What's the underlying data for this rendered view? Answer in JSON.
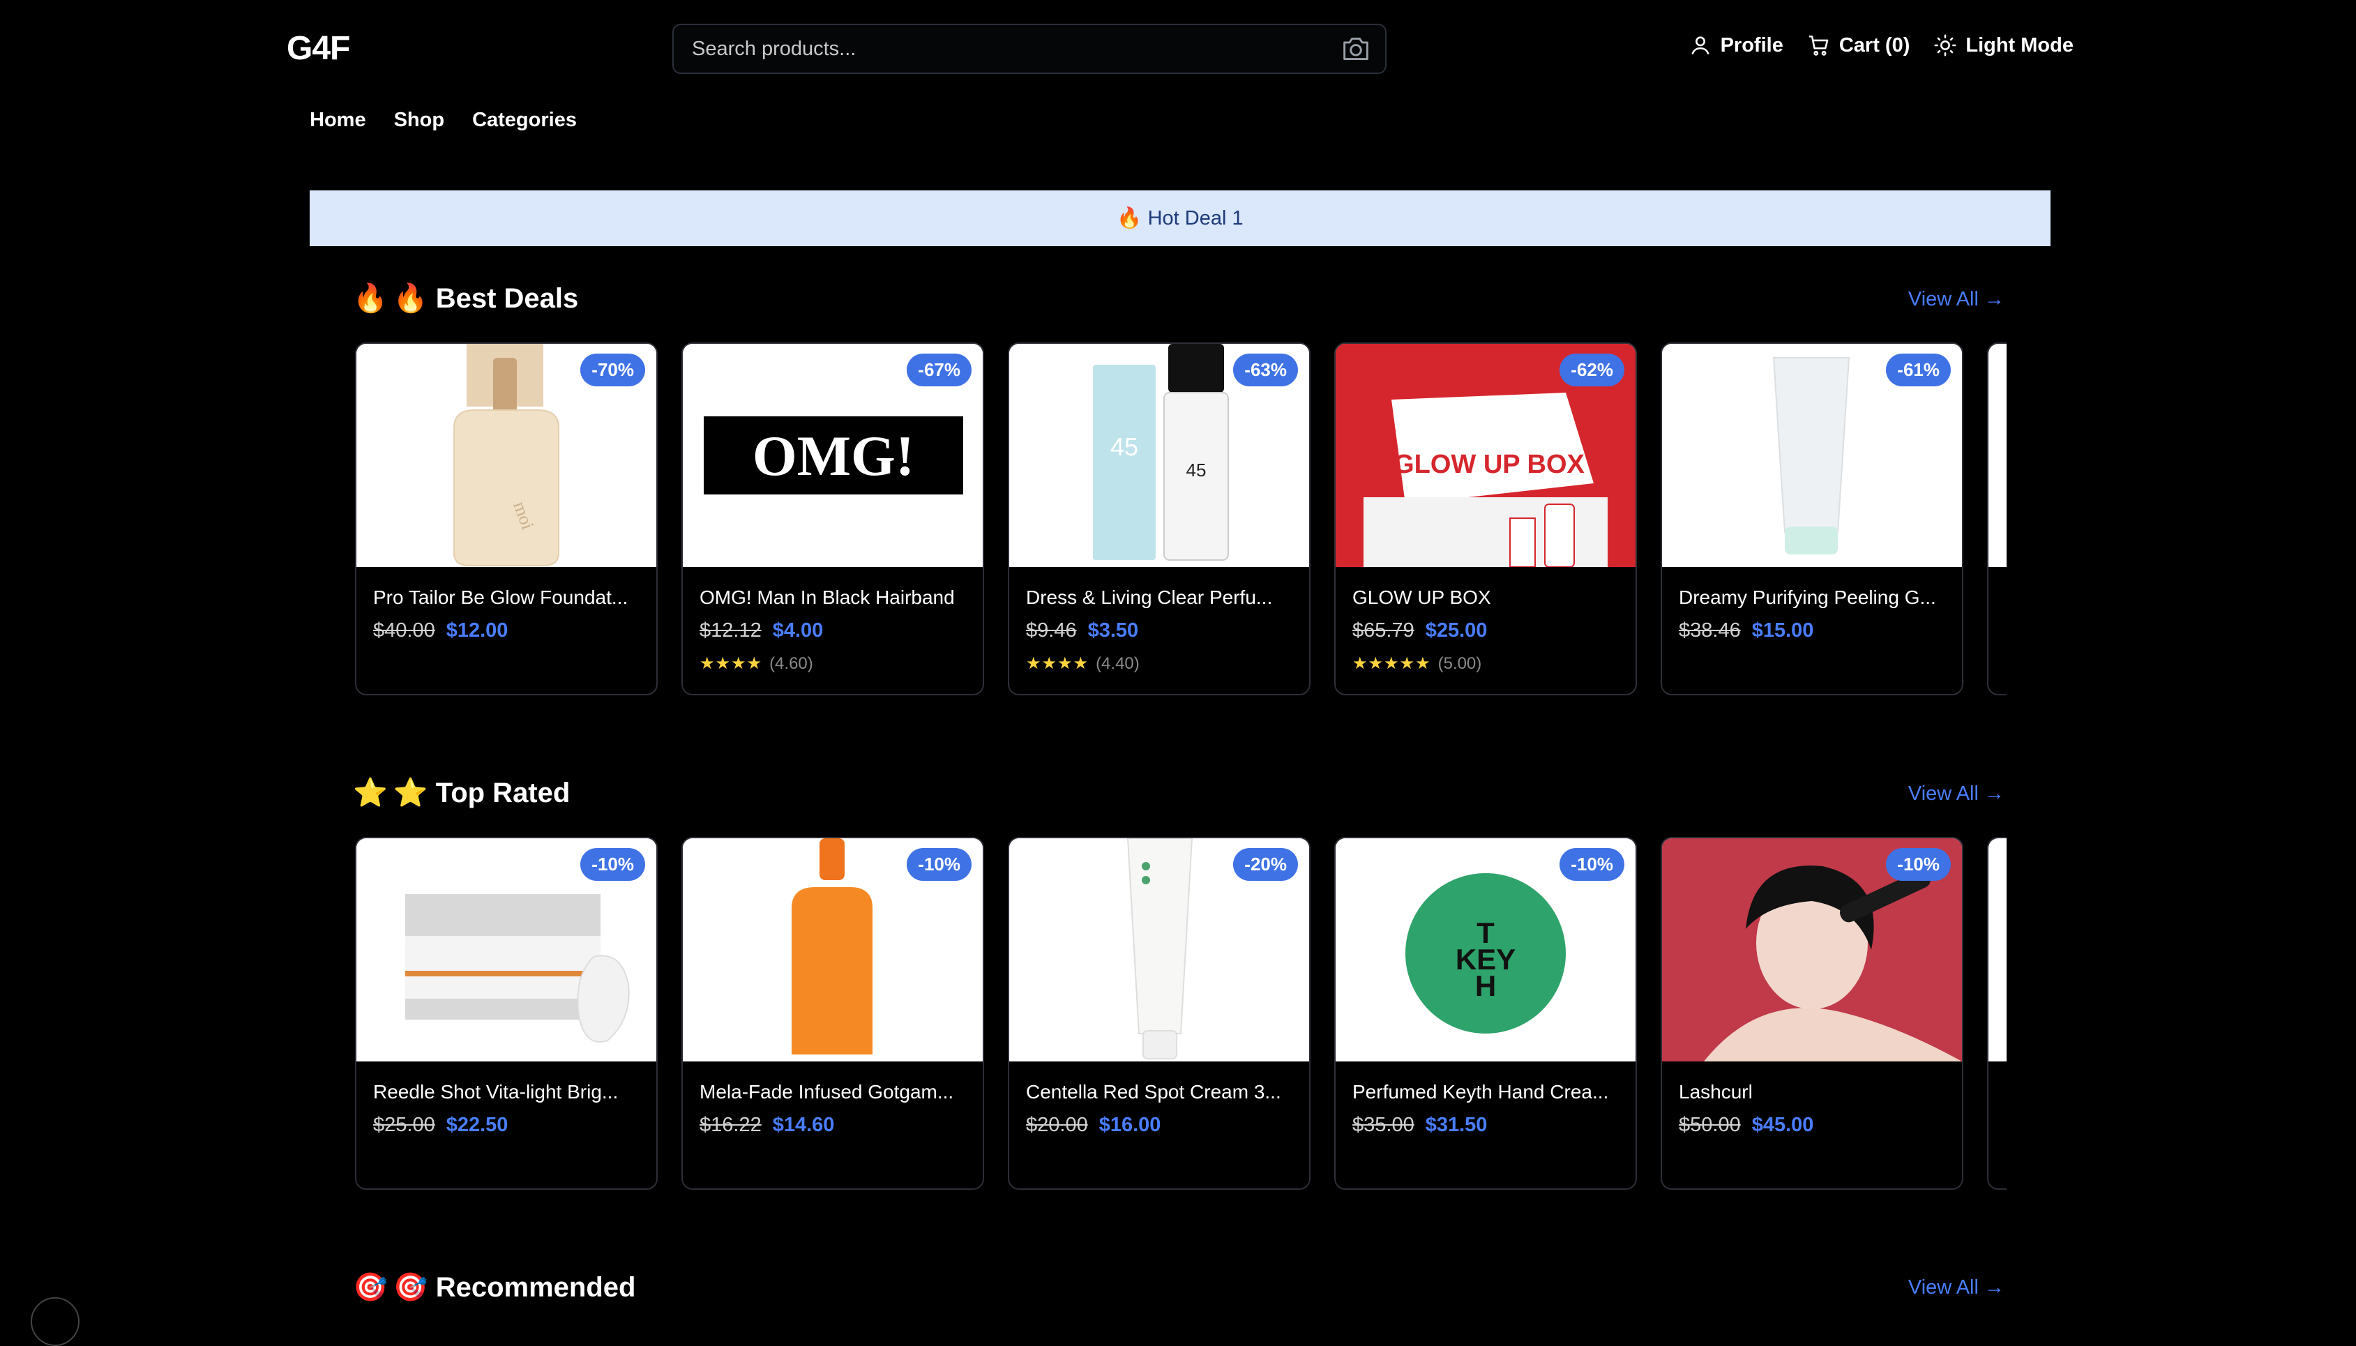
{
  "header": {
    "logo": "G4F",
    "search_placeholder": "Search products...",
    "profile_label": "Profile",
    "cart_label": "Cart (0)",
    "theme_label": "Light Mode"
  },
  "nav": {
    "items": [
      "Home",
      "Shop",
      "Categories"
    ]
  },
  "banner": {
    "text": "🔥 Hot Deal 1"
  },
  "sections": [
    {
      "icon": "🔥",
      "title": "🔥 Best Deals",
      "view_all": "View All →",
      "products": [
        {
          "name": "Pro Tailor Be Glow Foundat...",
          "old_price": "$40.00",
          "new_price": "$12.00",
          "discount": "-70%",
          "rating_stars": "",
          "rating": "",
          "image_icon": "foundation-bottle"
        },
        {
          "name": "OMG! Man In Black Hairband",
          "old_price": "$12.12",
          "new_price": "$4.00",
          "discount": "-67%",
          "rating_stars": "★★★★",
          "rating": "(4.60)",
          "image_icon": "omg-hairband"
        },
        {
          "name": "Dress & Living Clear Perfu...",
          "old_price": "$9.46",
          "new_price": "$3.50",
          "discount": "-63%",
          "rating_stars": "★★★★",
          "rating": "(4.40)",
          "image_icon": "perfume-bottles"
        },
        {
          "name": "GLOW UP BOX",
          "old_price": "$65.79",
          "new_price": "$25.00",
          "discount": "-62%",
          "rating_stars": "★★★★★",
          "rating": "(5.00)",
          "image_icon": "glow-up-box"
        },
        {
          "name": "Dreamy Purifying Peeling G...",
          "old_price": "$38.46",
          "new_price": "$15.00",
          "discount": "-61%",
          "rating_stars": "",
          "rating": "",
          "image_icon": "peeling-gel-tube"
        }
      ]
    },
    {
      "icon": "⭐",
      "title": "⭐ Top Rated",
      "view_all": "View All →",
      "products": [
        {
          "name": "Reedle Shot Vita-light Brig...",
          "old_price": "$25.00",
          "new_price": "$22.50",
          "discount": "-10%",
          "rating_stars": "",
          "rating": "",
          "image_icon": "mask-box"
        },
        {
          "name": "Mela-Fade Infused Gotgam...",
          "old_price": "$16.22",
          "new_price": "$14.60",
          "discount": "-10%",
          "rating_stars": "",
          "rating": "",
          "image_icon": "serum-dropper"
        },
        {
          "name": "Centella Red Spot Cream 3...",
          "old_price": "$20.00",
          "new_price": "$16.00",
          "discount": "-20%",
          "rating_stars": "",
          "rating": "",
          "image_icon": "cream-tube"
        },
        {
          "name": "Perfumed Keyth Hand Crea...",
          "old_price": "$35.00",
          "new_price": "$31.50",
          "discount": "-10%",
          "rating_stars": "",
          "rating": "",
          "image_icon": "keyth-tin"
        },
        {
          "name": "Lashcurl",
          "old_price": "$50.00",
          "new_price": "$45.00",
          "discount": "-10%",
          "rating_stars": "",
          "rating": "",
          "image_icon": "lash-curler-model"
        }
      ]
    },
    {
      "icon": "🎯",
      "title": "🎯 Recommended",
      "view_all": "View All →",
      "products": []
    }
  ]
}
